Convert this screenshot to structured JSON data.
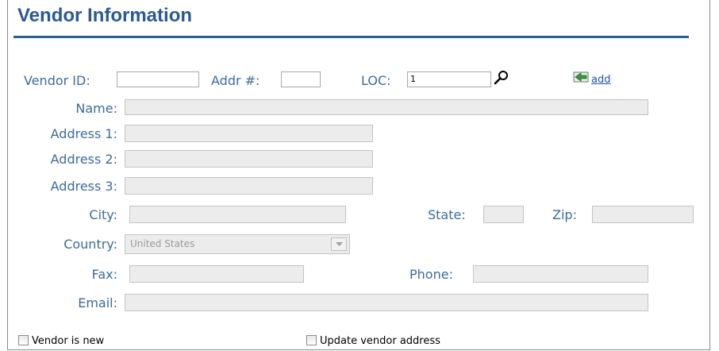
{
  "section": {
    "title": "Vendor Information"
  },
  "form": {
    "vendor_id": {
      "label": "Vendor ID:",
      "value": ""
    },
    "addr_no": {
      "label": "Addr #:",
      "value": ""
    },
    "loc": {
      "label": "LOC:",
      "value": "1"
    },
    "add_link": "add",
    "name": {
      "label": "Name:",
      "value": ""
    },
    "address1": {
      "label": "Address 1:",
      "value": ""
    },
    "address2": {
      "label": "Address 2:",
      "value": ""
    },
    "address3": {
      "label": "Address 3:",
      "value": ""
    },
    "city": {
      "label": "City:",
      "value": ""
    },
    "state": {
      "label": "State:",
      "value": ""
    },
    "zip": {
      "label": "Zip:",
      "value": ""
    },
    "country": {
      "label": "Country:",
      "value": "United States"
    },
    "fax": {
      "label": "Fax:",
      "value": ""
    },
    "phone": {
      "label": "Phone:",
      "value": ""
    },
    "email": {
      "label": "Email:",
      "value": ""
    }
  },
  "checkboxes": {
    "vendor_is_new": {
      "label": "Vendor is new",
      "checked": false
    },
    "update_vendor_address": {
      "label": "Update vendor address",
      "checked": false
    }
  },
  "colors": {
    "accent": "#2a5a93",
    "label": "#3d6b9a",
    "link": "#1f4fb8",
    "disabled_bg": "#ececec"
  },
  "icons": {
    "lookup": "search-icon",
    "add": "add-green-arrow-icon",
    "dropdown": "chevron-down-icon"
  }
}
